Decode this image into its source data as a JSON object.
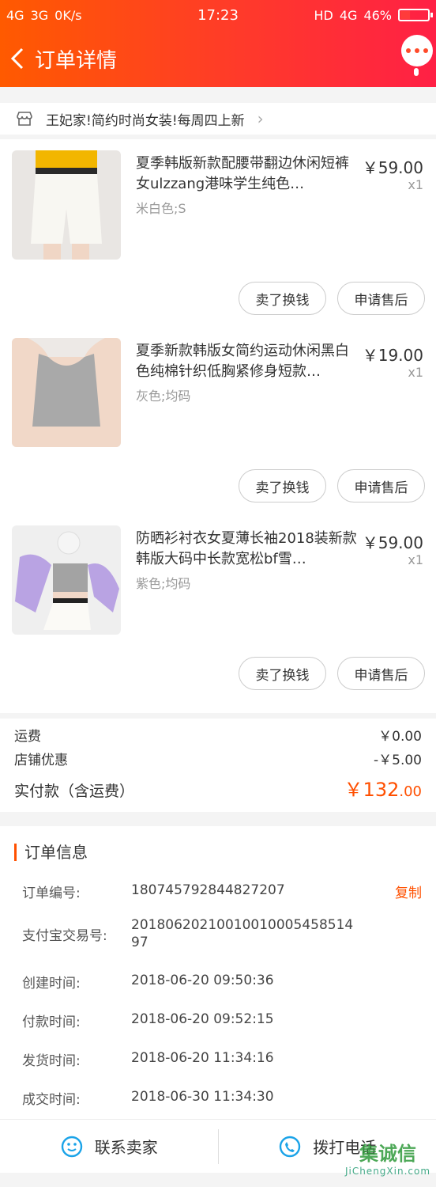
{
  "status_bar": {
    "left": [
      "4G",
      "3G",
      "0K/s"
    ],
    "time": "17:23",
    "right": [
      "HD",
      "4G",
      "46%"
    ]
  },
  "nav": {
    "title": "订单详情"
  },
  "store": {
    "name": "王妃家!简约时尚女装!每周四上新"
  },
  "items": [
    {
      "title": "夏季韩版新款配腰带翻边休闲短裤女ulzzang港味学生纯色…",
      "sku": "米白色;S",
      "price": "￥59.00",
      "qty": "x1",
      "btn_sell": "卖了换钱",
      "btn_refund": "申请售后"
    },
    {
      "title": "夏季新款韩版女简约运动休闲黑白色纯棉针织低胸紧修身短款…",
      "sku": "灰色;均码",
      "price": "￥19.00",
      "qty": "x1",
      "btn_sell": "卖了换钱",
      "btn_refund": "申请售后"
    },
    {
      "title": "防晒衫衬衣女夏薄长袖2018装新款韩版大码中长款宽松bf雪…",
      "sku": "紫色;均码",
      "price": "￥59.00",
      "qty": "x1",
      "btn_sell": "卖了换钱",
      "btn_refund": "申请售后"
    }
  ],
  "fees": {
    "shipping_label": "运费",
    "shipping_value": "￥0.00",
    "discount_label": "店铺优惠",
    "discount_value": "-￥5.00",
    "total_label": "实付款（含运费）",
    "total_main": "￥132",
    "total_decimal": ".00"
  },
  "order_info": {
    "title": "订单信息",
    "copy_label": "复制",
    "rows": [
      {
        "label": "订单编号:",
        "value": "180745792844827207"
      },
      {
        "label": "支付宝交易号:",
        "value": "2018062021001001000545851497"
      },
      {
        "label": "创建时间:",
        "value": "2018-06-20 09:50:36"
      },
      {
        "label": "付款时间:",
        "value": "2018-06-20 09:52:15"
      },
      {
        "label": "发货时间:",
        "value": "2018-06-20 11:34:16"
      },
      {
        "label": "成交时间:",
        "value": "2018-06-30 11:34:30"
      }
    ]
  },
  "bottom": {
    "contact": "联系卖家",
    "call": "拨打电话"
  },
  "watermark": {
    "main": "集诚信",
    "sub": "JiChengXin.com"
  },
  "colors": {
    "accent": "#ff5000",
    "header_start": "#ff5a00",
    "header_end": "#ff2045"
  }
}
